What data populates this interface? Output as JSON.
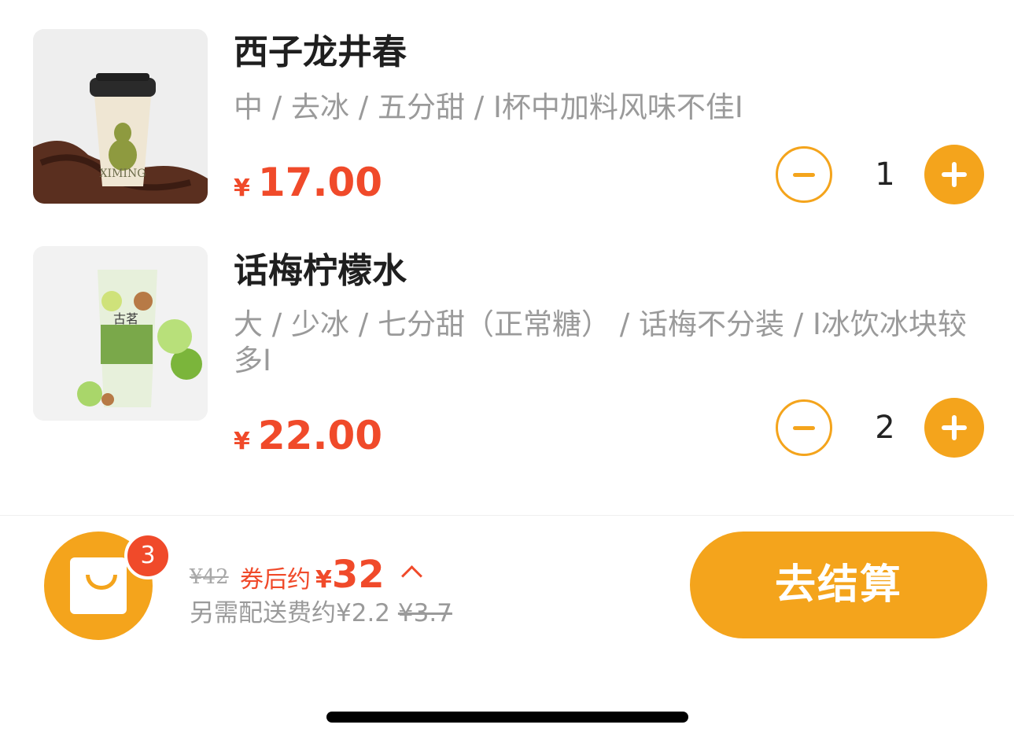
{
  "items": [
    {
      "name": "西子龙井春",
      "spec": "中 / 去冰 / 五分甜 / I杯中加料风味不佳I",
      "currency": "¥",
      "price": "17.00",
      "qty": "1",
      "cup_text": "XIMING"
    },
    {
      "name": "话梅柠檬水",
      "spec": "大 / 少冰 / 七分甜（正常糖） / 话梅不分装 / I冰饮冰块较多I",
      "currency": "¥",
      "price": "22.00",
      "qty": "2",
      "cup_text": "古茗"
    }
  ],
  "cart": {
    "badge_count": "3",
    "original_total": "¥42",
    "coupon_label": "券后约",
    "currency": "¥",
    "after_coupon_amount": "32",
    "delivery_text": "另需配送费约¥2.2",
    "delivery_original": "¥3.7",
    "checkout_label": "去结算"
  },
  "colors": {
    "accent": "#f4a41c",
    "price_red": "#f04a2a"
  }
}
